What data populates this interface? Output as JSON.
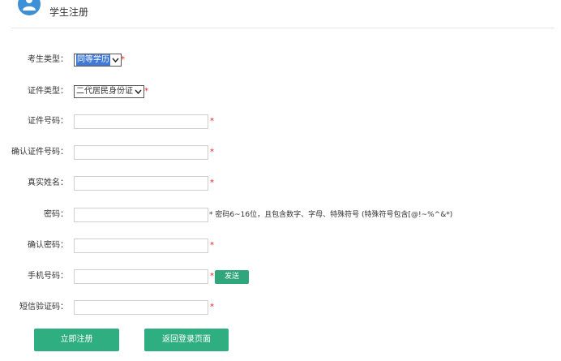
{
  "header": {
    "title": "学生注册",
    "icon": "user-avatar-icon"
  },
  "form": {
    "exam_type": {
      "label": "考生类型：",
      "value": "同等学历"
    },
    "id_type": {
      "label": "证件类型：",
      "value": "二代居民身份证"
    },
    "id_number": {
      "label": "证件号码：",
      "value": ""
    },
    "confirm_id_number": {
      "label": "确认证件号码：",
      "value": ""
    },
    "real_name": {
      "label": "真实姓名：",
      "value": ""
    },
    "password": {
      "label": "密码：",
      "value": "",
      "hint": "* 密码6~16位，且包含数字、字母、特殊符号 (特殊符号包含[@!~%^&*)"
    },
    "confirm_password": {
      "label": "确认密码：",
      "value": ""
    },
    "phone": {
      "label": "手机号码：",
      "value": ""
    },
    "sms_code": {
      "label": "短信验证码：",
      "value": ""
    },
    "required_mark": "*"
  },
  "buttons": {
    "send": "发送",
    "register": "立即注册",
    "back_to_login": "返回登录页面"
  },
  "colors": {
    "accent_green": "#2fae82",
    "avatar_blue": "#3d8fd6",
    "required_red": "#ee2222"
  }
}
